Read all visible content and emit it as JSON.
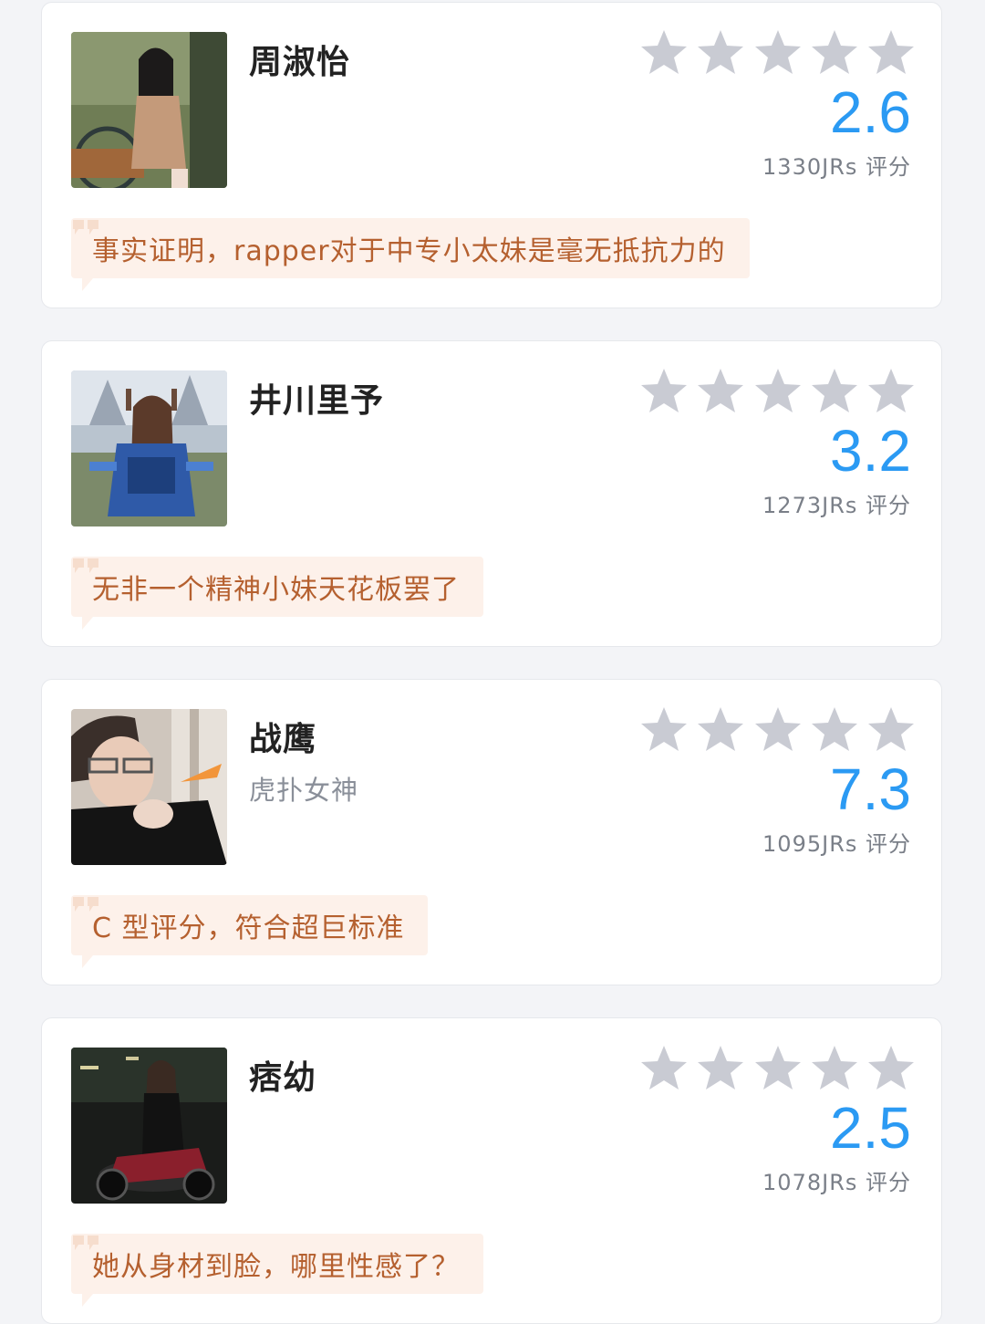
{
  "colors": {
    "page_background": "#f3f4f7",
    "card_background": "#ffffff",
    "score": "#2b9af3",
    "star_empty": "#c9cbd3",
    "comment_background": "#fdf1ea",
    "comment_text": "#b5602f",
    "name": "#222222",
    "subtitle": "#8a8f99",
    "votes": "#7a7f88"
  },
  "star_icon": "star-icon",
  "cards": [
    {
      "name": "周淑怡",
      "subtitle": "",
      "score": "2.6",
      "votes": "1330JRs 评分",
      "stars_filled": 0,
      "stars_total": 5,
      "comment": "事实证明，rapper对于中专小太妹是毫无抵抗力的"
    },
    {
      "name": "井川里予",
      "subtitle": "",
      "score": "3.2",
      "votes": "1273JRs 评分",
      "stars_filled": 0,
      "stars_total": 5,
      "comment": "无非一个精神小妹天花板罢了"
    },
    {
      "name": "战鹰",
      "subtitle": "虎扑女神",
      "score": "7.3",
      "votes": "1095JRs 评分",
      "stars_filled": 0,
      "stars_total": 5,
      "comment": "C 型评分，符合超巨标准"
    },
    {
      "name": "痞幼",
      "subtitle": "",
      "score": "2.5",
      "votes": "1078JRs 评分",
      "stars_filled": 0,
      "stars_total": 5,
      "comment": "她从身材到脸，哪里性感了？"
    }
  ]
}
